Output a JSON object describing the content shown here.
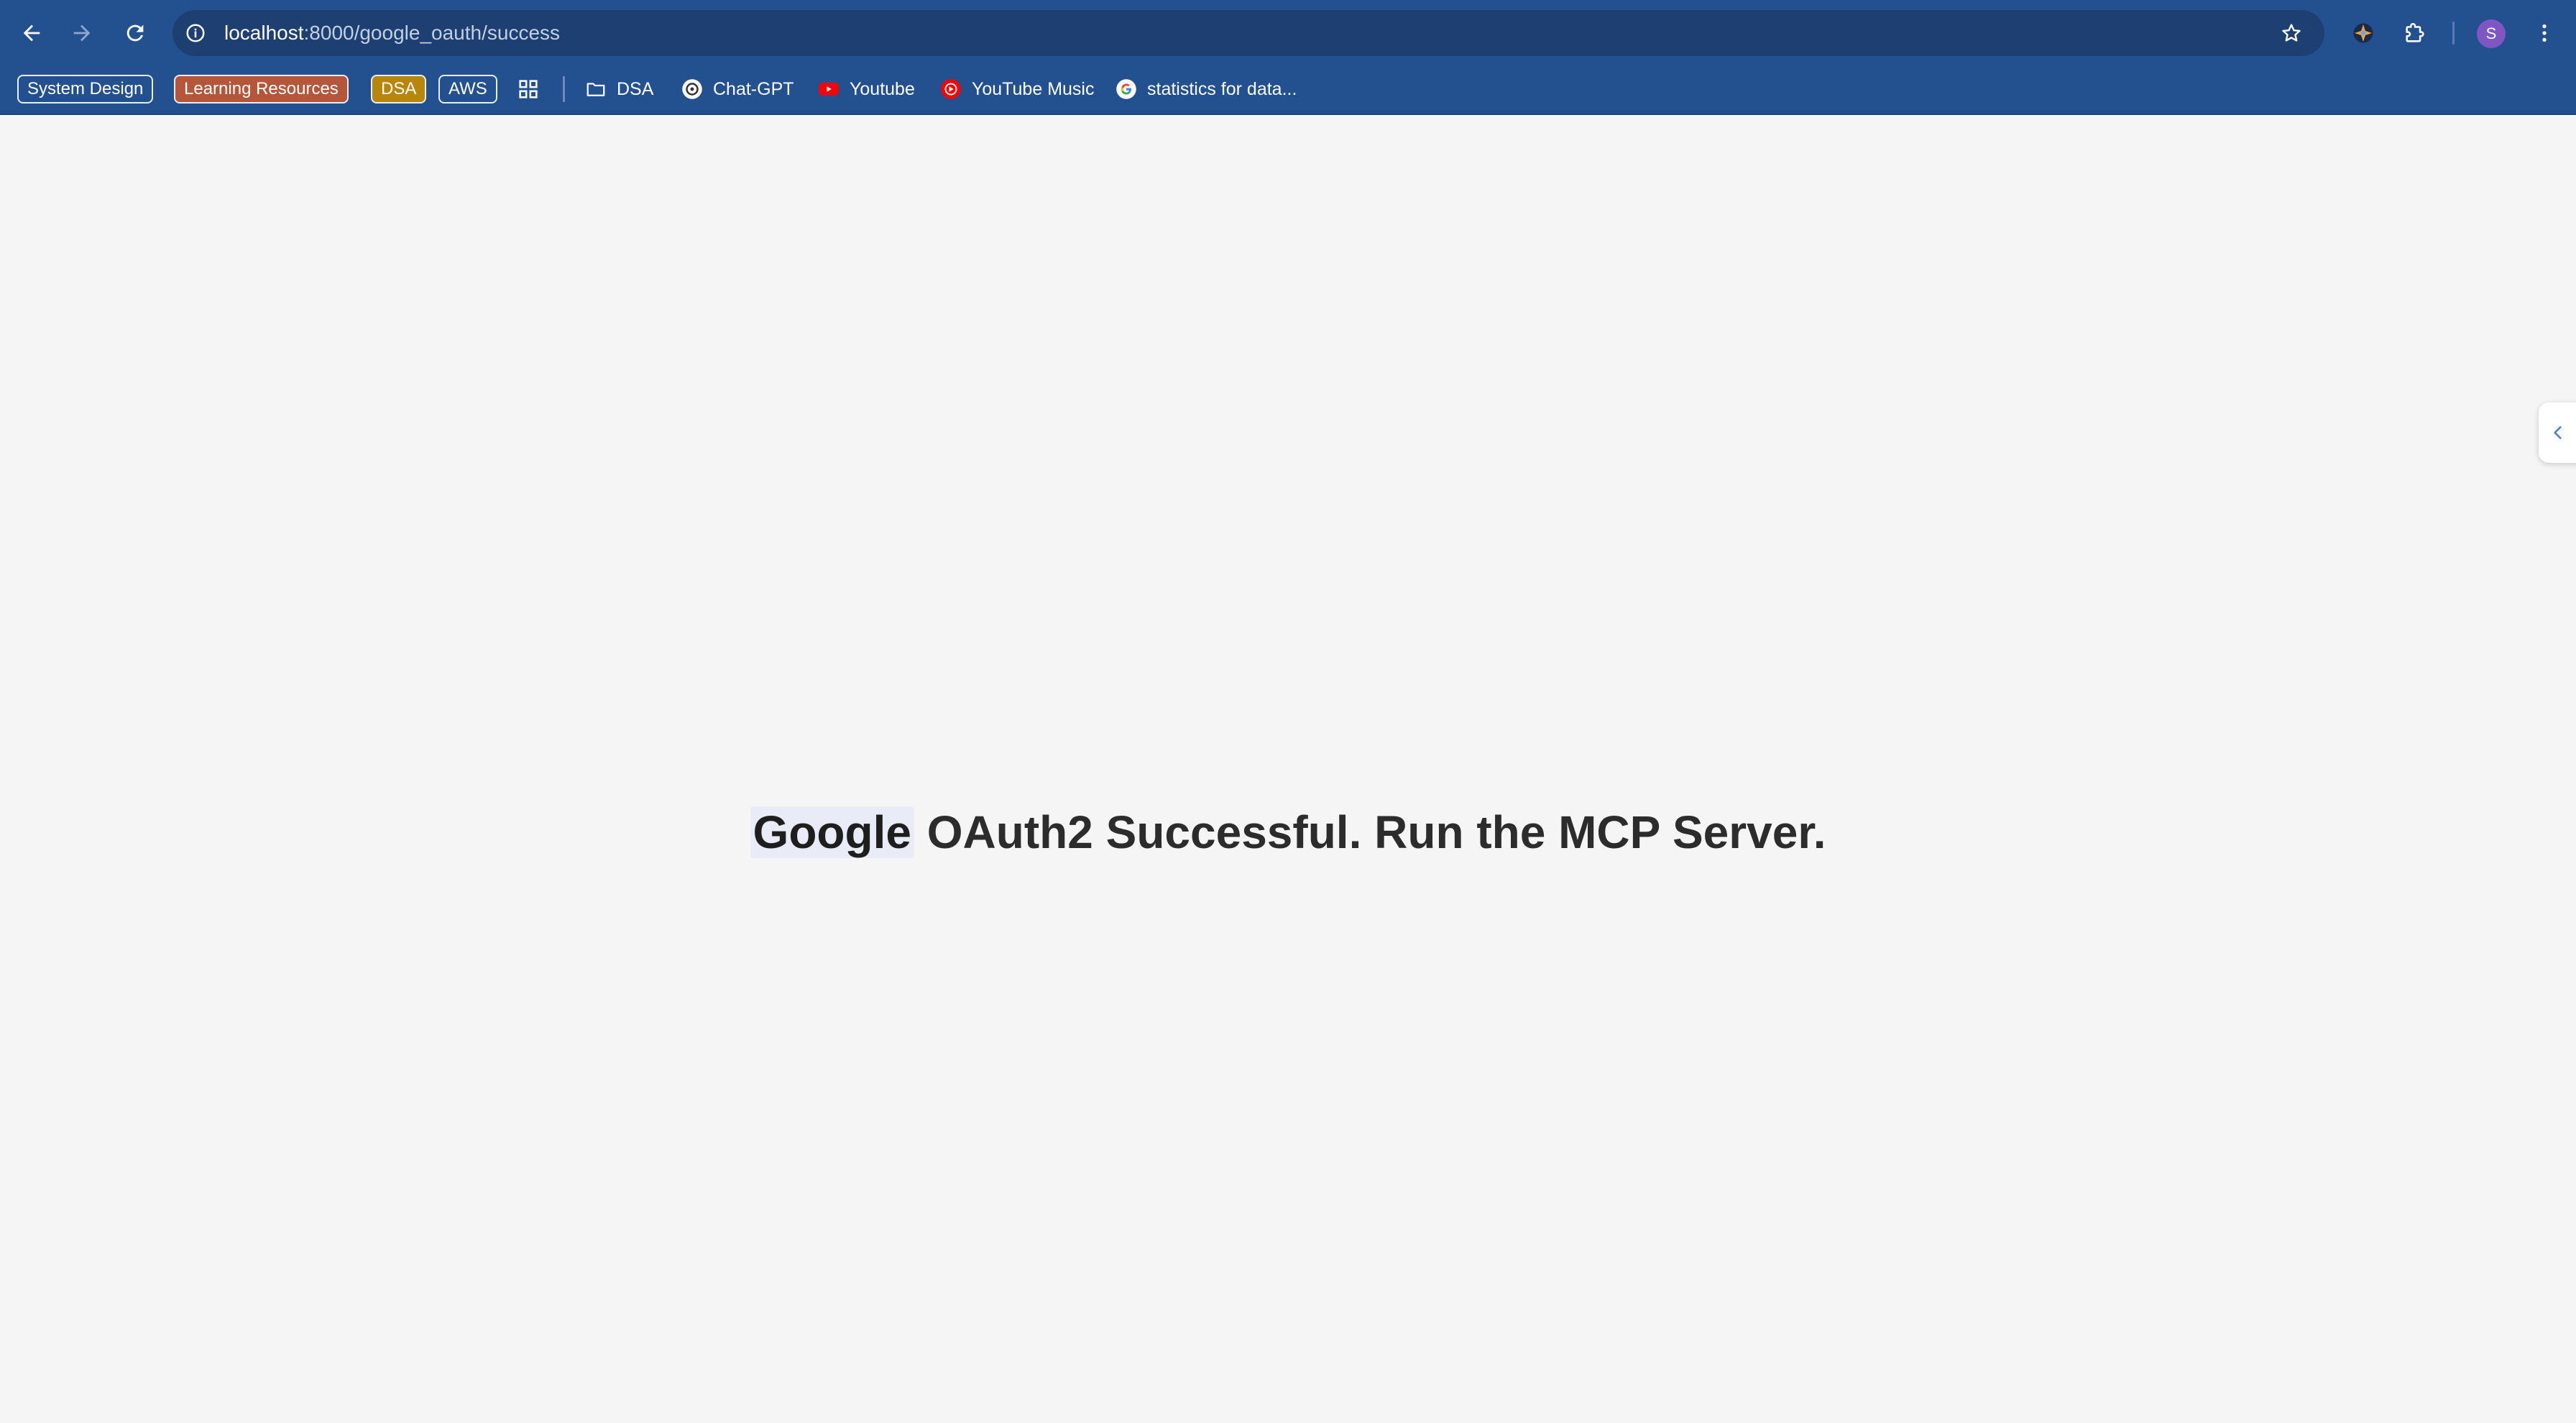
{
  "browser": {
    "url_host": "localhost",
    "url_path": ":8000/google_oauth/success",
    "profile_initial": "S"
  },
  "bookmarks": {
    "chips": [
      {
        "label": "System Design",
        "color": "#23508f"
      },
      {
        "label": "Learning Resources",
        "color": "#b5553a"
      },
      {
        "label": "DSA",
        "color": "#b8860b"
      },
      {
        "label": "AWS",
        "color": "#23508f"
      }
    ],
    "items": [
      {
        "label": "DSA",
        "icon": "folder-icon"
      },
      {
        "label": "Chat-GPT",
        "icon": "chatgpt-icon"
      },
      {
        "label": "Youtube",
        "icon": "youtube-icon"
      },
      {
        "label": "YouTube Music",
        "icon": "youtube-music-icon"
      },
      {
        "label": "statistics for data...",
        "icon": "google-icon"
      }
    ]
  },
  "page": {
    "headline_highlight": "Google",
    "headline_rest": " OAuth2 Successful. Run the MCP Server."
  }
}
